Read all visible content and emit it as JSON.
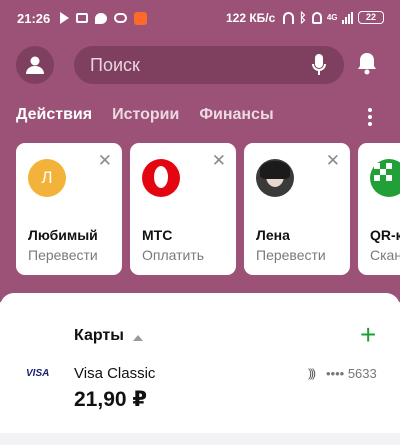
{
  "status_bar": {
    "time": "21:26",
    "speed": "122 КБ/с",
    "network": "4G",
    "battery": "22",
    "icons": [
      "play-icon",
      "mail-icon",
      "chat-icon",
      "cloud-icon",
      "app-icon",
      "headphones-icon",
      "bluetooth-icon",
      "mute-bell-icon",
      "signal-icon",
      "battery-icon"
    ]
  },
  "header": {
    "search_placeholder": "Поиск",
    "icons": [
      "profile-icon",
      "microphone-icon",
      "bell-icon"
    ]
  },
  "tabs": [
    {
      "label": "Действия",
      "active": true
    },
    {
      "label": "Истории",
      "active": false
    },
    {
      "label": "Финансы",
      "active": false
    }
  ],
  "quick_actions": [
    {
      "name": "Любимый",
      "subtitle": "Перевести",
      "avatar_letter": "Л",
      "avatar_color": "#f3b33a"
    },
    {
      "name": "МТС",
      "subtitle": "Оплатить",
      "avatar_color": "#e30611"
    },
    {
      "name": "Лена",
      "subtitle": "Перевести"
    },
    {
      "name": "QR-к",
      "subtitle": "Скан",
      "avatar_color": "#21a038"
    }
  ],
  "cards_section": {
    "title": "Карты",
    "add_label": "+",
    "card": {
      "brand": "VISA",
      "name": "Visa Classic",
      "masked_number": "•••• 5633",
      "balance": "21,90 ₽"
    }
  },
  "colors": {
    "background": "#9c5276",
    "search_bg": "#7f3f5e",
    "accent_green": "#21a038"
  }
}
